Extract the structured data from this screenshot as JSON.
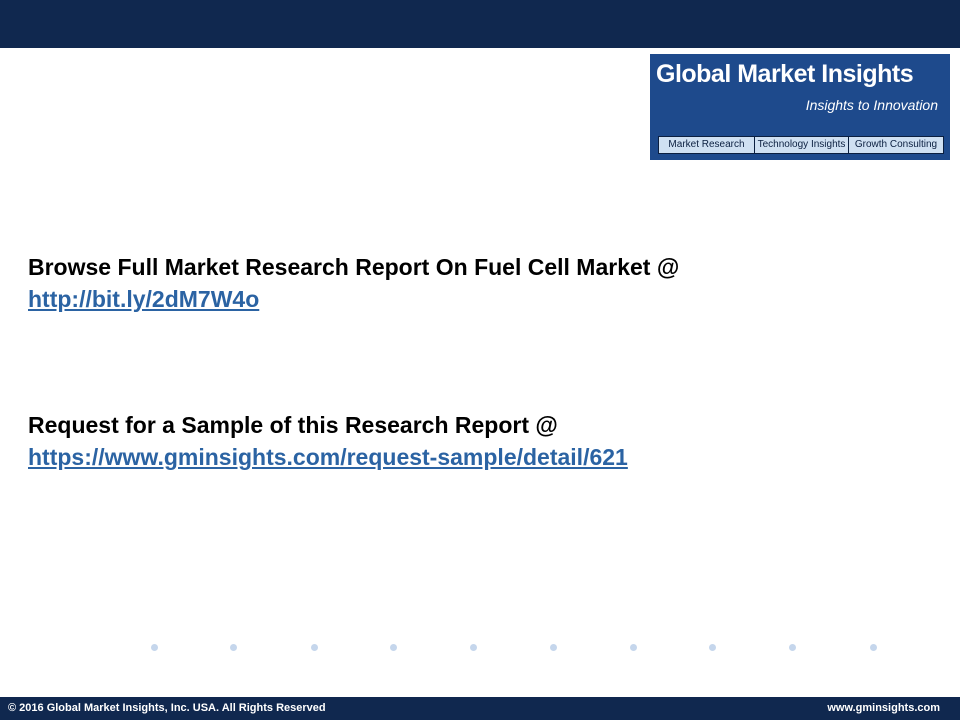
{
  "logo": {
    "title": "Global Market Insights",
    "tagline": "Insights to Innovation",
    "items": [
      "Market Research",
      "Technology Insights",
      "Growth Consulting"
    ]
  },
  "content": {
    "browse_text": "Browse Full Market Research Report On Fuel Cell Market @",
    "browse_link": "http://bit.ly/2dM7W4o",
    "sample_text": "Request for a Sample of this Research Report @",
    "sample_link": "https://www.gminsights.com/request-sample/detail/621"
  },
  "footer": {
    "copyright": "© 2016 Global Market Insights, Inc. USA.  All Rights Reserved",
    "website": "www.gminsights.com"
  },
  "colors": {
    "header_bar": "#10284f",
    "logo_bg": "#1e4a8c",
    "link": "#2b63a3",
    "dot": "#c5d6ec"
  }
}
